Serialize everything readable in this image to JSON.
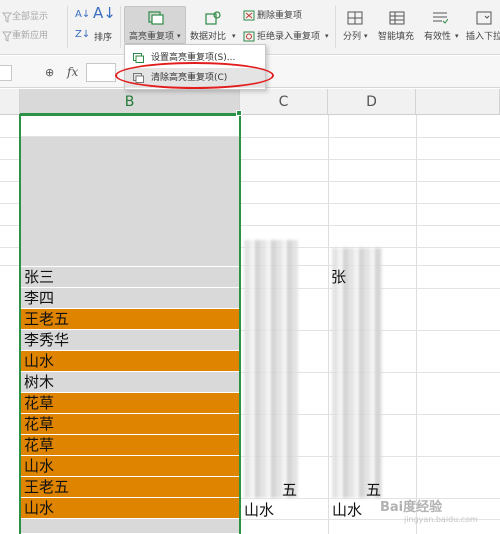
{
  "ribbon": {
    "show_all": "全部显示",
    "reapply": "重新应用",
    "sort": "排序",
    "highlight_dup": "高亮重复项",
    "data_compare": "数据对比",
    "delete_dup": "删除重复项",
    "reject_dup": "拒绝录入重复项",
    "split": "分列",
    "flash_fill": "智能填充",
    "validity": "有效性",
    "insert_dropdown": "插入下拉"
  },
  "dropdown": {
    "items": [
      {
        "label": "设置高亮重复项(S)..."
      },
      {
        "label": "清除高亮重复项(C)"
      }
    ]
  },
  "formula_bar": {
    "fx": "fx"
  },
  "columns": [
    "B",
    "C",
    "D"
  ],
  "column_b": [
    {
      "text": "张三",
      "fill": "grey"
    },
    {
      "text": "李四",
      "fill": "grey"
    },
    {
      "text": "王老五",
      "fill": "orange"
    },
    {
      "text": "李秀华",
      "fill": "grey"
    },
    {
      "text": "山水",
      "fill": "orange"
    },
    {
      "text": "树木",
      "fill": "grey"
    },
    {
      "text": "花草",
      "fill": "orange"
    },
    {
      "text": "花草",
      "fill": "orange"
    },
    {
      "text": "花草",
      "fill": "orange"
    },
    {
      "text": "山水",
      "fill": "orange"
    },
    {
      "text": "王老五",
      "fill": "orange"
    },
    {
      "text": "山水",
      "fill": "orange"
    }
  ],
  "visible_c": {
    "last": "山水",
    "partial": "五"
  },
  "visible_d": {
    "first": "张",
    "last": "山水",
    "partial": "五"
  },
  "colors": {
    "orange": "#df8400",
    "grey": "#d9d9d9",
    "selection": "#2a9145",
    "annotation": "#e21d1d"
  },
  "watermark": {
    "text": "Bai度经验",
    "sub": "jingyan.baidu.com"
  }
}
